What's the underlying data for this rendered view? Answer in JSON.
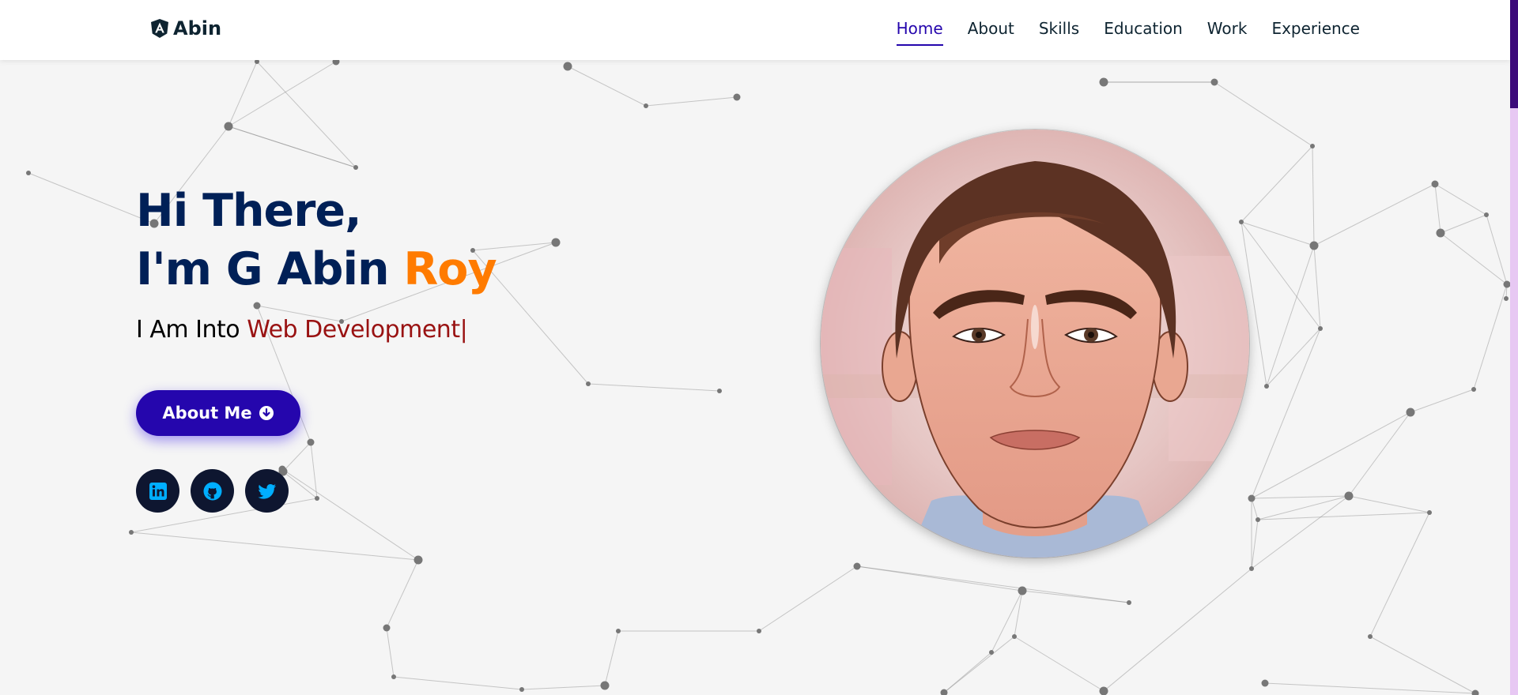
{
  "brand": {
    "name": "Abin",
    "icon": "angular-shield-icon"
  },
  "nav": {
    "items": [
      {
        "label": "Home",
        "active": true
      },
      {
        "label": "About",
        "active": false
      },
      {
        "label": "Skills",
        "active": false
      },
      {
        "label": "Education",
        "active": false
      },
      {
        "label": "Work",
        "active": false
      },
      {
        "label": "Experience",
        "active": false
      }
    ]
  },
  "hero": {
    "greeting": "Hi There,",
    "intro_prefix": "I'm G Abin ",
    "intro_highlight": "Roy",
    "role_prefix": "I Am Into ",
    "role_text": "Web Development|",
    "about_button": "About Me",
    "about_button_icon": "arrow-down-circle-icon",
    "socials": [
      {
        "name": "linkedin",
        "icon": "linkedin-icon"
      },
      {
        "name": "github",
        "icon": "github-icon"
      },
      {
        "name": "twitter",
        "icon": "twitter-icon"
      }
    ]
  },
  "colors": {
    "heading": "#002057",
    "accent_orange": "#ff7b00",
    "role_red": "#991212",
    "button_purple": "#2506ad",
    "active_nav": "#2506ad",
    "social_bg": "#0e1630",
    "social_icon": "#00aeff"
  }
}
